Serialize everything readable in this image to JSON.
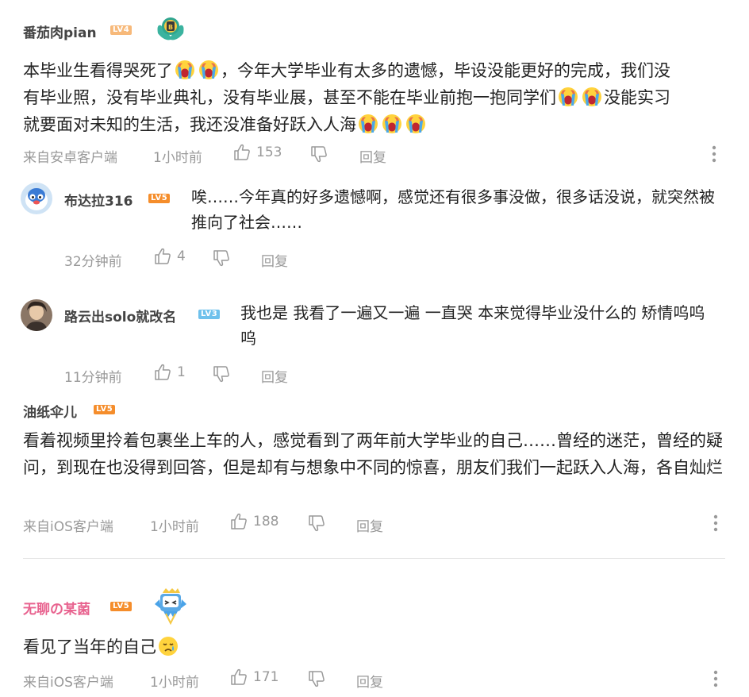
{
  "comments": [
    {
      "user": "番茄肉pian",
      "level": "LV4",
      "text1": "本毕业生看得哭死了",
      "text2": "，今年大学毕业有太多的遗憾，毕设没能更好的完成，我们没",
      "text3": "有毕业照，没有毕业典礼，没有毕业展，甚至不能在毕业前抱一抱同学们",
      "text4": "没能实习",
      "text5": "就要面对未知的生活，我还没准备好跃入人海",
      "source": "来自安卓客户端",
      "time": "1小时前",
      "likes": "153",
      "reply_label": "回复",
      "replies": [
        {
          "user": "布达拉316",
          "level": "LV5",
          "text": "唉……今年真的好多遗憾啊，感觉还有很多事没做，很多话没说，就突然被推向了社会……",
          "time": "32分钟前",
          "likes": "4",
          "reply_label": "回复"
        },
        {
          "user": "路云出solo就改名",
          "level": "LV3",
          "text": "我也是 我看了一遍又一遍 一直哭 本来觉得毕业没什么的 矫情呜呜呜",
          "time": "11分钟前",
          "likes": "1",
          "reply_label": "回复"
        }
      ]
    },
    {
      "user": "油纸伞儿",
      "level": "LV5",
      "text": "看着视频里拎着包裹坐上车的人，感觉看到了两年前大学毕业的自己……曾经的迷茫，曾经的疑问，到现在也没得到回答，但是却有与想象中不同的惊喜，朋友们我们一起跃入人海，各自灿烂",
      "source": "来自iOS客户端",
      "time": "1小时前",
      "likes": "188",
      "reply_label": "回复"
    },
    {
      "user": "无聊の某菌",
      "level": "LV5",
      "text": "看见了当年的自己",
      "source": "来自iOS客户端",
      "time": "1小时前",
      "likes": "171",
      "reply_label": "回复"
    }
  ],
  "colors": {
    "meta_gray": "#999999",
    "pink_username": "#e8638f",
    "level_orange": "#f58d2b",
    "level_blue": "#6fc1ec"
  },
  "icons": [
    "thumbs-up-icon",
    "thumbs-down-icon",
    "more-vertical-icon",
    "crying-emoji-icon",
    "sad-emoji-icon",
    "badge-icon"
  ]
}
